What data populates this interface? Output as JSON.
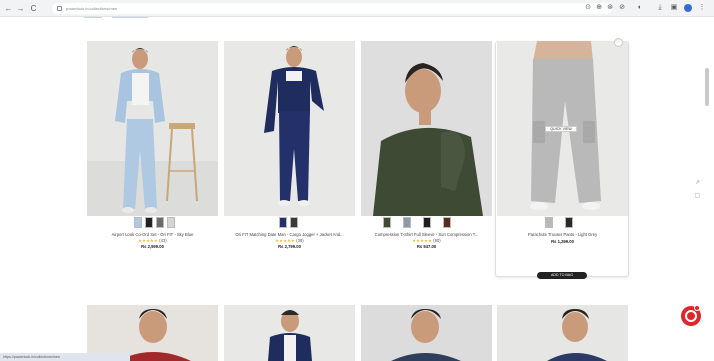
{
  "browser": {
    "url": "powerlook.in/collections/men",
    "nav": {
      "back": "←",
      "forward": "→",
      "reload": "C"
    },
    "extension_icons": [
      "⊙",
      "⊕",
      "⊛",
      "⊘",
      "◐",
      "⤓",
      "▣",
      "⋮"
    ]
  },
  "products": [
    {
      "title": "Airport Look Co-Ord Set - Ori FIT - Sky Blue",
      "stars": "★★★★★",
      "reviews": "(43)",
      "price": "Rs 2,999.00",
      "swatch_count": 4
    },
    {
      "title": "Ori FIT Matching Date Man - Cargo Jogger + Jacket And...",
      "stars": "★★★★★",
      "reviews": "(38)",
      "price": "Rs 2,799.00",
      "swatch_count": 2
    },
    {
      "title": "Compression T-Shirt Full Sleeve - Sun Compression T...",
      "stars": "★★★★★",
      "reviews": "(90)",
      "price": "Rs 947.00",
      "swatch_count": 4
    },
    {
      "title": "Parachute Trouser Pants - Light Grey",
      "stars": "",
      "reviews": "",
      "price": "Rs 1,299.00",
      "swatch_count": 2
    }
  ],
  "hover": {
    "quick_view_label": "QUICK VIEW",
    "add_to_bag_label": "ADD TO BAG",
    "wishlist_icon": "heart-icon"
  },
  "colors": {
    "accent": "#e0262b",
    "star": "#f2b01e"
  },
  "status_bar": "https://powerlook.in/collections/men"
}
